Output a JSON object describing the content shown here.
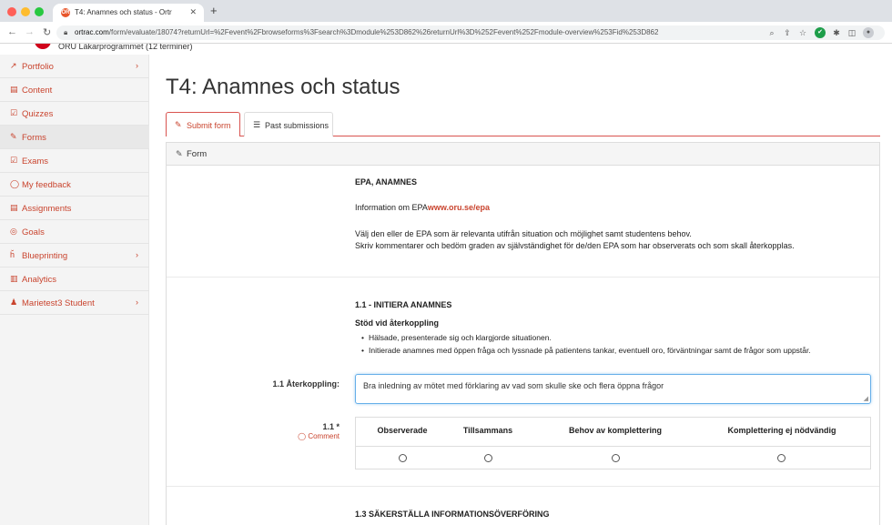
{
  "browser": {
    "tab_title": "T4: Anamnes och status - Ortr",
    "tab_favicon": "OR",
    "url_domain": "ortrac.com",
    "url_path": "/form/evaluate/18074?returnUrl=%2Fevent%2Fbrowseforms%3Fsearch%3Dmodule%253D862%26returnUrl%3D%252Fevent%252Fmodule-overview%253Fid%253D862"
  },
  "program": {
    "name": "ÖRU Läkarprogrammet (12 terminer)"
  },
  "sidebar": {
    "items": [
      {
        "label": "Portfolio",
        "icon": "line-chart-icon",
        "has_children": true
      },
      {
        "label": "Content",
        "icon": "document-icon",
        "has_children": false
      },
      {
        "label": "Quizzes",
        "icon": "checkbox-icon",
        "has_children": false
      },
      {
        "label": "Forms",
        "icon": "edit-icon",
        "has_children": false,
        "active": true
      },
      {
        "label": "Exams",
        "icon": "checkbox-icon",
        "has_children": false
      },
      {
        "label": "My feedback",
        "icon": "comment-icon",
        "has_children": false
      },
      {
        "label": "Assignments",
        "icon": "document-icon",
        "has_children": false
      },
      {
        "label": "Goals",
        "icon": "target-icon",
        "has_children": false
      },
      {
        "label": "Blueprinting",
        "icon": "sitemap-icon",
        "has_children": true
      },
      {
        "label": "Analytics",
        "icon": "bar-chart-icon",
        "has_children": false
      },
      {
        "label": "Marietest3 Student",
        "icon": "user-icon",
        "has_children": true
      }
    ]
  },
  "page": {
    "title": "T4: Anamnes och status"
  },
  "tabs": [
    {
      "label": "Submit form",
      "icon": "edit-icon",
      "active": true
    },
    {
      "label": "Past submissions",
      "icon": "list-icon",
      "active": false
    }
  ],
  "form": {
    "header": "Form",
    "intro": {
      "heading": "EPA,  ANAMNES",
      "info_prefix": "Information om EPA",
      "info_link": "www.oru.se/epa",
      "line1": "Välj den eller de EPA som är relevanta utifrån situation och möjlighet samt studentens behov.",
      "line2": "Skriv kommentarer och bedöm graden av självständighet för de/den EPA som har observerats och som skall återkopplas."
    },
    "section1": {
      "heading": "1.1 - INITIERA ANAMNES",
      "support_heading": "Stöd vid återkoppling",
      "bullets": [
        "Hälsade, presenterade sig och klargjorde situationen.",
        "Initierade anamnes med öppen fråga och lyssnade på patientens tankar, eventuell oro, förväntningar samt de frågor som uppstår."
      ],
      "feedback_label": "1.1 Återkoppling:",
      "feedback_value": "Bra inledning av mötet med förklaring av vad som skulle ske och flera öppna frågor",
      "rating_label": "1.1",
      "required_mark": "*",
      "comment_label": "Comment",
      "rating_options": [
        "Observerade",
        "Tillsammans",
        "Behov av komplettering",
        "Komplettering ej nödvändig"
      ]
    },
    "section3": {
      "heading": "1.3 SÄKERSTÄLLA INFORMATIONSÖVERFÖRING"
    }
  }
}
